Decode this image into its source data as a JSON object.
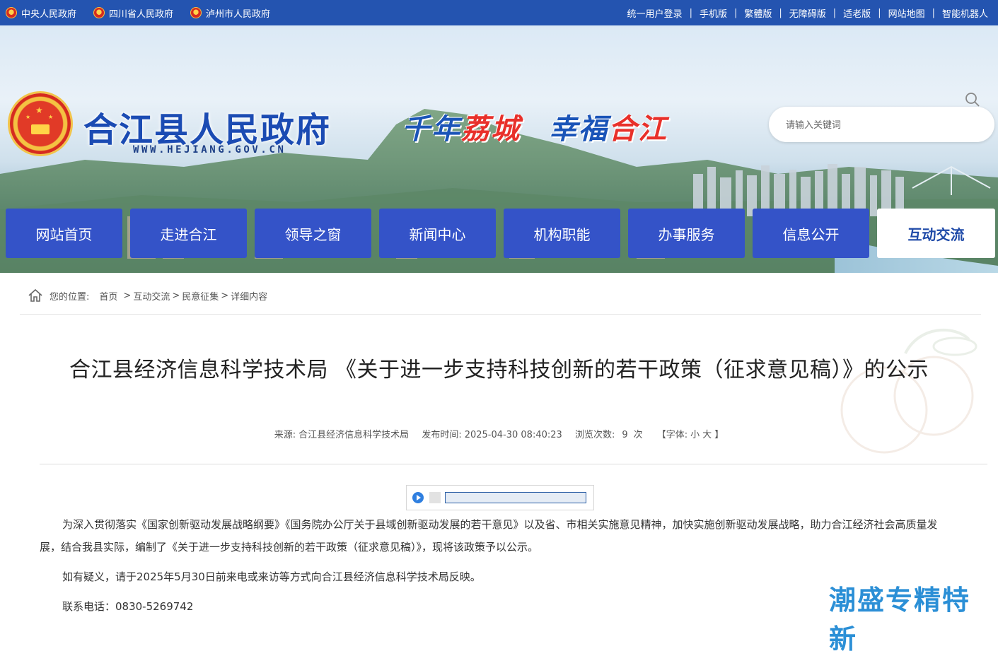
{
  "topbar": {
    "gov_links": [
      "中央人民政府",
      "四川省人民政府",
      "泸州市人民政府"
    ],
    "utility_links": [
      "统一用户登录",
      "手机版",
      "繁體版",
      "无障碍版",
      "适老版",
      "网站地图",
      "智能机器人"
    ],
    "separator": "|"
  },
  "header": {
    "site_title": "合江县人民政府",
    "site_url": "WWW.HEJIANG.GOV.CN",
    "slogan": {
      "part1": "千年",
      "part2": "荔城",
      "part3": "幸福",
      "part4": "合江"
    },
    "search_placeholder": "请输入关键词"
  },
  "nav": {
    "items": [
      "网站首页",
      "走进合江",
      "领导之窗",
      "新闻中心",
      "机构职能",
      "办事服务",
      "信息公开",
      "互动交流"
    ],
    "active_index": 7
  },
  "breadcrumb": {
    "prefix": "您的位置:",
    "items": [
      "首页",
      "互动交流",
      "民意征集",
      "详细内容"
    ],
    "separator": ">"
  },
  "article": {
    "title": "合江县经济信息科学技术局 《关于进一步支持科技创新的若干政策（征求意见稿）》的公示",
    "meta": {
      "source_label": "来源:",
      "source": "合江县经济信息科学技术局",
      "date_label": "发布时间:",
      "date": "2025-04-30 08:40:23",
      "views_label": "浏览次数:",
      "views": "9",
      "views_unit": "次",
      "font_label": "【字体:",
      "font_small": "小",
      "font_large": "大",
      "font_end": "】"
    },
    "paragraphs": [
      "为深入贯彻落实《国家创新驱动发展战略纲要》《国务院办公厅关于县域创新驱动发展的若干意见》以及省、市相关实施意见精神，加快实施创新驱动发展战略，助力合江经济社会高质量发展，结合我县实际，编制了《关于进一步支持科技创新的若干政策（征求意见稿）》，现将该政策予以公示。",
      "如有疑义，请于2025年5月30日前来电或来访等方式向合江县经济信息科学技术局反映。",
      "联系电话：0830-5269742"
    ]
  },
  "corner_brand": "潮盛专精特新",
  "colors": {
    "topbar": "#2454b0",
    "nav": "#3453c8",
    "accent_red": "#e8302a",
    "title_blue": "#1b4bb3"
  }
}
